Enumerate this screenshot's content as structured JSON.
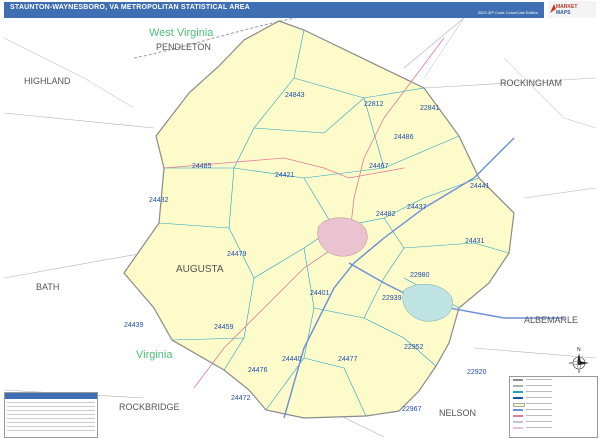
{
  "header": {
    "title": "STAUNTON-WAYNESBORO, VA METROPOLITAN STATISTICAL AREA",
    "edition": "2023 ZIP Code Color/Cast Edition"
  },
  "logo": {
    "line1": "MARKET",
    "line2": "MAPS"
  },
  "colors": {
    "metro_fill": "#fdfbc9",
    "outside_fill": "#ffffff",
    "metro_border": "#8a8a8a",
    "zip_boundary": "#1fa1c9",
    "zip_label": "#1f4fb0",
    "city_staunton": "#e9c3cf",
    "city_waynesboro": "#bfe3e3",
    "road_interstate": "#6a8fd8",
    "road_highway": "#e07a9a",
    "state_label": "#4fc07a",
    "county_label": "#555555"
  },
  "map": {
    "state_labels": [
      {
        "id": "west-virginia",
        "text": "West Virginia"
      },
      {
        "id": "virginia",
        "text": "Virginia"
      }
    ],
    "county_labels": [
      {
        "id": "pendleton",
        "text": "PENDLETON"
      },
      {
        "id": "highland",
        "text": "HIGHLAND"
      },
      {
        "id": "rockingham",
        "text": "ROCKINGHAM"
      },
      {
        "id": "augusta",
        "text": "AUGUSTA"
      },
      {
        "id": "bath",
        "text": "BATH"
      },
      {
        "id": "albemarle",
        "text": "ALBEMARLE"
      },
      {
        "id": "rockbridge",
        "text": "ROCKBRIDGE"
      },
      {
        "id": "nelson",
        "text": "NELSON"
      }
    ],
    "zip_labels": [
      {
        "id": "z24843",
        "text": "24843"
      },
      {
        "id": "z22812",
        "text": "22812"
      },
      {
        "id": "z22841",
        "text": "22841"
      },
      {
        "id": "z24486",
        "text": "24486"
      },
      {
        "id": "z24485",
        "text": "24485"
      },
      {
        "id": "z24467",
        "text": "24467"
      },
      {
        "id": "z24421",
        "text": "24421"
      },
      {
        "id": "z24441",
        "text": "24441"
      },
      {
        "id": "z24432",
        "text": "24432"
      },
      {
        "id": "z24482",
        "text": "24482"
      },
      {
        "id": "z24437",
        "text": "24437"
      },
      {
        "id": "z24431",
        "text": "24431"
      },
      {
        "id": "z24479",
        "text": "24479"
      },
      {
        "id": "z22980",
        "text": "22980"
      },
      {
        "id": "z24401",
        "text": "24401"
      },
      {
        "id": "z22939",
        "text": "22939"
      },
      {
        "id": "z24459",
        "text": "24459"
      },
      {
        "id": "z24439",
        "text": "24439"
      },
      {
        "id": "z24476",
        "text": "24476"
      },
      {
        "id": "z24440",
        "text": "24440"
      },
      {
        "id": "z24477",
        "text": "24477"
      },
      {
        "id": "z22952",
        "text": "22952"
      },
      {
        "id": "z22920",
        "text": "22920"
      },
      {
        "id": "z24472",
        "text": "24472"
      },
      {
        "id": "z22967",
        "text": "22967"
      }
    ]
  },
  "compass": {
    "label": "N"
  }
}
